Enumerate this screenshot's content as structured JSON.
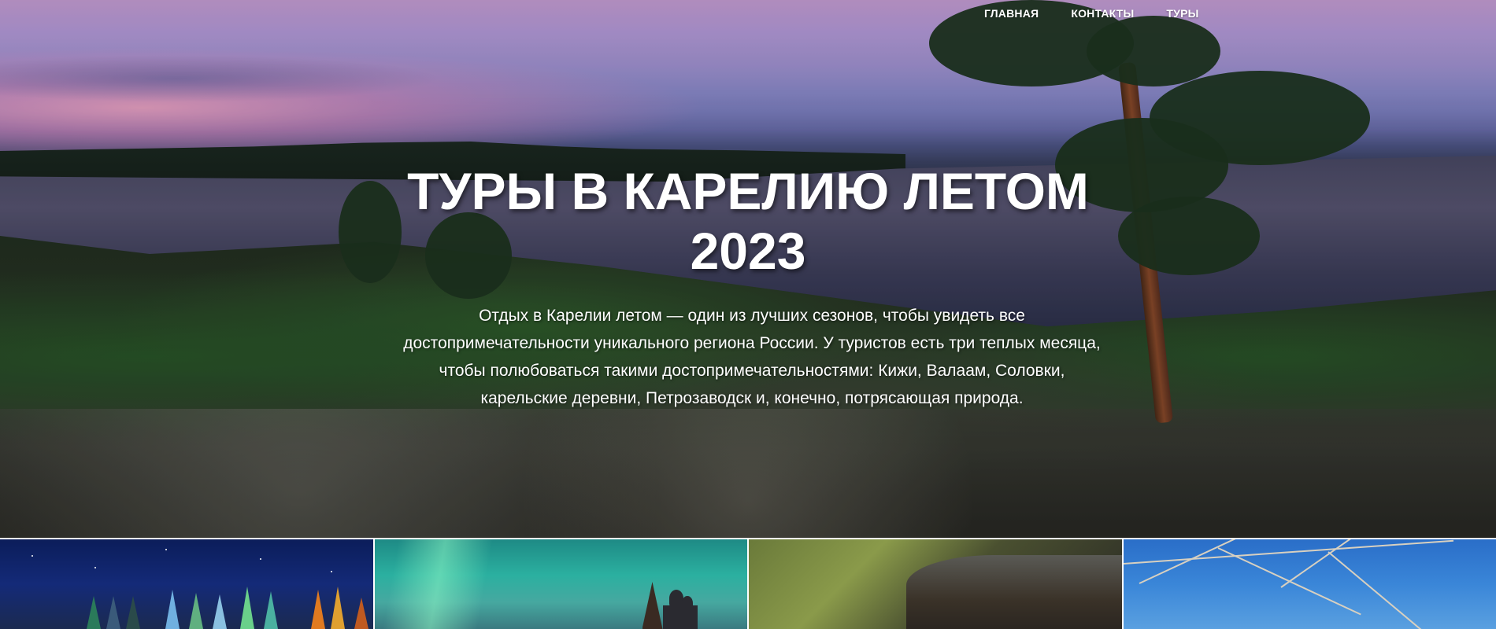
{
  "nav": {
    "items": [
      {
        "label": "ГЛАВНАЯ"
      },
      {
        "label": "КОНТАКТЫ"
      },
      {
        "label": "ТУРЫ"
      }
    ]
  },
  "hero": {
    "title_line1": "ТУРЫ В КАРЕЛИЮ ЛЕТОМ",
    "title_line2": "2023",
    "paragraph_line1": "Отдых в Карелии летом — один из лучших сезонов, чтобы увидеть все",
    "paragraph_line2": "достопримечательности уникального региона России. У туристов есть три теплых месяца,",
    "paragraph_line3": "чтобы полюбоваться такими достопримечательностями: Кижи, Валаам, Соловки,",
    "paragraph_line4": "карельские деревни, Петрозаводск и, конечно, потрясающая природа."
  },
  "colors": {
    "text": "#ffffff",
    "gallery_separator": "#ffffff"
  }
}
